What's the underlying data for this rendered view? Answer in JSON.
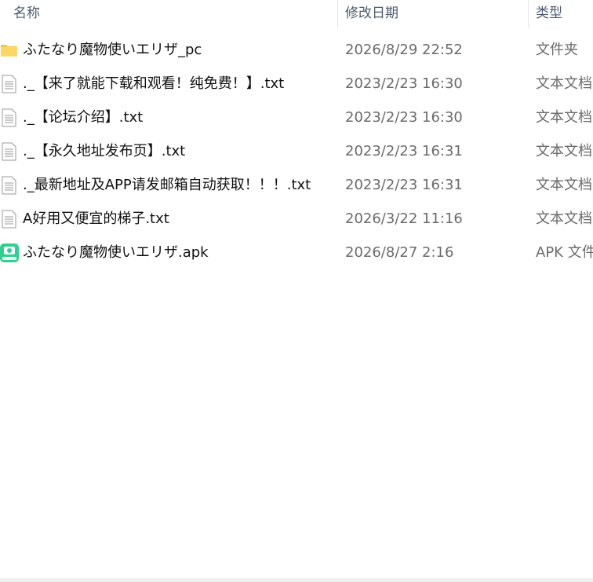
{
  "columns": {
    "name": "名称",
    "date": "修改日期",
    "type": "类型"
  },
  "files": [
    {
      "icon": "folder-icon",
      "name": "ふたなり魔物使いエリザ_pc",
      "date": "2026/8/29 22:52",
      "type": "文件夹"
    },
    {
      "icon": "text-file-icon",
      "name": "._【来了就能下载和观看！纯免费！】.txt",
      "date": "2023/2/23 16:30",
      "type": "文本文档"
    },
    {
      "icon": "text-file-icon",
      "name": "._【论坛介绍】.txt",
      "date": "2023/2/23 16:30",
      "type": "文本文档"
    },
    {
      "icon": "text-file-icon",
      "name": "._【永久地址发布页】.txt",
      "date": "2023/2/23 16:31",
      "type": "文本文档"
    },
    {
      "icon": "text-file-icon",
      "name": "._最新地址及APP请发邮箱自动获取！！！.txt",
      "date": "2023/2/23 16:31",
      "type": "文本文档"
    },
    {
      "icon": "text-file-icon",
      "name": "A好用又便宜的梯子.txt",
      "date": "2026/3/22 11:16",
      "type": "文本文档"
    },
    {
      "icon": "apk-file-icon",
      "name": "ふたなり魔物使いエリザ.apk",
      "date": "2026/8/27 2:16",
      "type": "APK 文件"
    }
  ]
}
